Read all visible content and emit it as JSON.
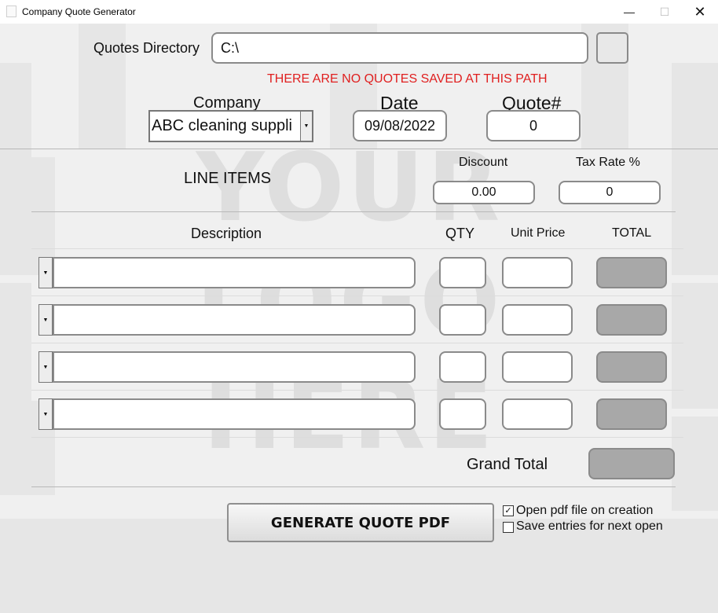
{
  "window": {
    "title": "Company Quote Generator",
    "minimize_icon": "minimize-icon",
    "maximize_icon": "maximize-icon",
    "close_icon": "close-icon"
  },
  "watermark": [
    "YOUR",
    "LOGO",
    "HERE"
  ],
  "directory": {
    "label": "Quotes Directory",
    "value": "C:\\",
    "browse_label": ""
  },
  "warning": {
    "text": "THERE ARE NO QUOTES SAVED AT THIS PATH",
    "color": "#e02020"
  },
  "header": {
    "company_label": "Company",
    "company_value": "ABC cleaning suppli",
    "date_label": "Date",
    "date_value": "09/08/2022",
    "quote_label": "Quote#",
    "quote_value": "0"
  },
  "line_items": {
    "title": "LINE ITEMS",
    "discount_label": "Discount",
    "discount_value": "0.00",
    "tax_label": "Tax Rate %",
    "tax_value": "0",
    "columns": [
      "Description",
      "QTY",
      "Unit Price",
      "TOTAL"
    ],
    "rows": [
      {
        "description": "",
        "qty": "",
        "unit_price": "",
        "total": ""
      },
      {
        "description": "",
        "qty": "",
        "unit_price": "",
        "total": ""
      },
      {
        "description": "",
        "qty": "",
        "unit_price": "",
        "total": ""
      },
      {
        "description": "",
        "qty": "",
        "unit_price": "",
        "total": ""
      }
    ]
  },
  "grand_total": {
    "label": "Grand Total",
    "value": ""
  },
  "actions": {
    "generate_label": "GENERATE QUOTE PDF",
    "open_pdf_label": "Open pdf file on creation",
    "open_pdf_checked": true,
    "save_entries_label": "Save entries for next open",
    "save_entries_checked": false
  },
  "colors": {
    "background": "#f0f0f0",
    "total_field": "#a8a8a8",
    "warning": "#e02020"
  }
}
